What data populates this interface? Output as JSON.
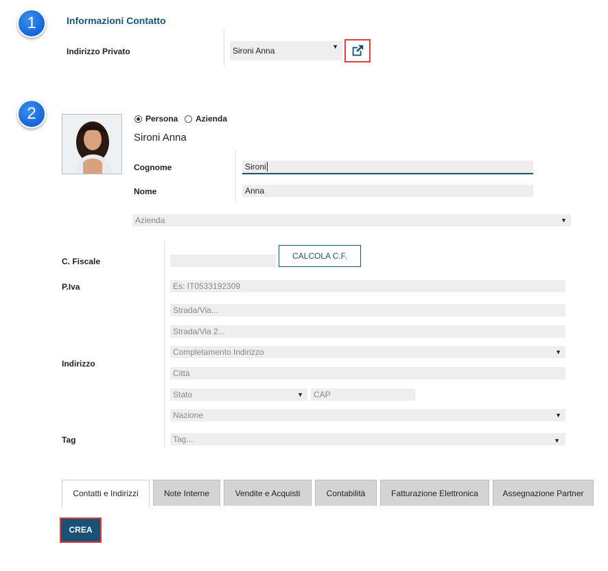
{
  "steps": {
    "one": "1",
    "two": "2"
  },
  "contact_section": {
    "title": "Informazioni Contatto",
    "private_address_label": "Indirizzo Privato",
    "private_address_value": "Sironi Anna",
    "external_link_icon": "external-link-icon"
  },
  "person": {
    "type_options": [
      "Persona",
      "Azienda"
    ],
    "selected_type": "Persona",
    "display_name": "Sironi Anna",
    "surname_label": "Cognome",
    "surname_value": "Sironi",
    "name_label": "Nome",
    "name_value": "Anna",
    "company_placeholder": "Azienda"
  },
  "fiscal": {
    "cf_label": "C. Fiscale",
    "cf_value": "",
    "calc_button": "CALCOLA C.F.",
    "piva_label": "P.Iva",
    "piva_placeholder": "Es: IT0533192309"
  },
  "address": {
    "label": "Indirizzo",
    "street_placeholder": "Strada/Via...",
    "street2_placeholder": "Strada/Via 2...",
    "completion_placeholder": "Completamento Indirizzo",
    "city_placeholder": "Città",
    "state_placeholder": "Stato",
    "zip_placeholder": "CAP",
    "country_placeholder": "Nazione"
  },
  "tag": {
    "label": "Tag",
    "placeholder": "Tag..."
  },
  "tabs": [
    {
      "label": "Contatti e Indirizzi",
      "active": true
    },
    {
      "label": "Note Interne",
      "active": false
    },
    {
      "label": "Vendite e Acquisti",
      "active": false
    },
    {
      "label": "Contabilità",
      "active": false
    },
    {
      "label": "Fatturazione Elettronica",
      "active": false
    },
    {
      "label": "Assegnazione Partner",
      "active": false
    }
  ],
  "actions": {
    "create": "CREA"
  },
  "colors": {
    "accent": "#1a5276",
    "highlight": "#e03c3c",
    "step_badge": "#1565d8"
  }
}
